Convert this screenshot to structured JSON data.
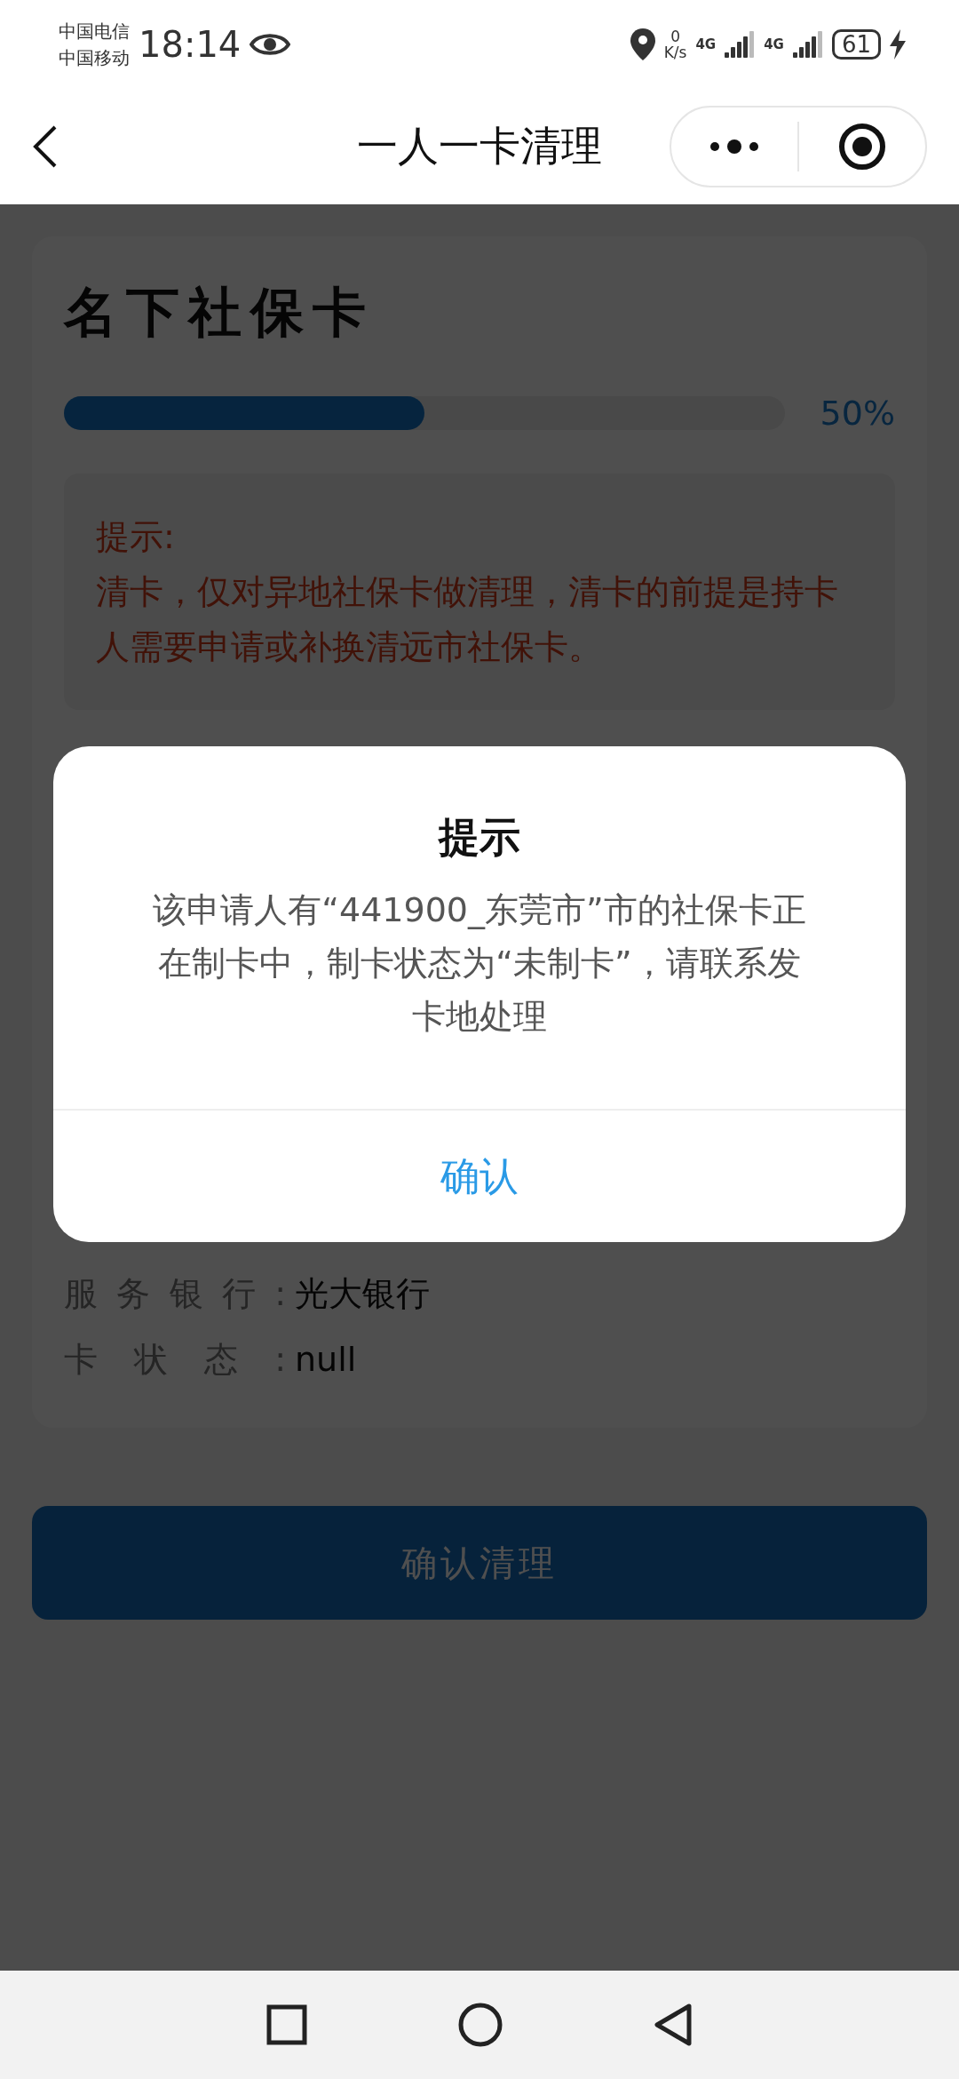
{
  "status_bar": {
    "carriers": [
      "中国电信",
      "中国移动"
    ],
    "time": "18:14",
    "speed_value": "0",
    "speed_unit": "K/s",
    "networks": [
      "4G",
      "4G"
    ],
    "battery": "61"
  },
  "nav_bar": {
    "title": "一人一卡清理"
  },
  "card": {
    "title": "名下社保卡",
    "progress": {
      "level": 0.5,
      "label": "50%"
    },
    "tip": {
      "heading": "提示:",
      "text": "清卡，仅对异地社保卡做清理，清卡的前提是持卡人需要申请或补换清远市社保卡。"
    },
    "fields": [
      {
        "label": "服务银行:",
        "value": "光大银行"
      },
      {
        "label": "卡状态:",
        "value": "null"
      }
    ]
  },
  "primary_button": {
    "label": "确认清理"
  },
  "dialog": {
    "title": "提示",
    "message": "该申请人有“441900_东莞市”市的社保卡正在制卡中，制卡状态为“未制卡”，请联系发卡地处理",
    "button": "确认"
  }
}
